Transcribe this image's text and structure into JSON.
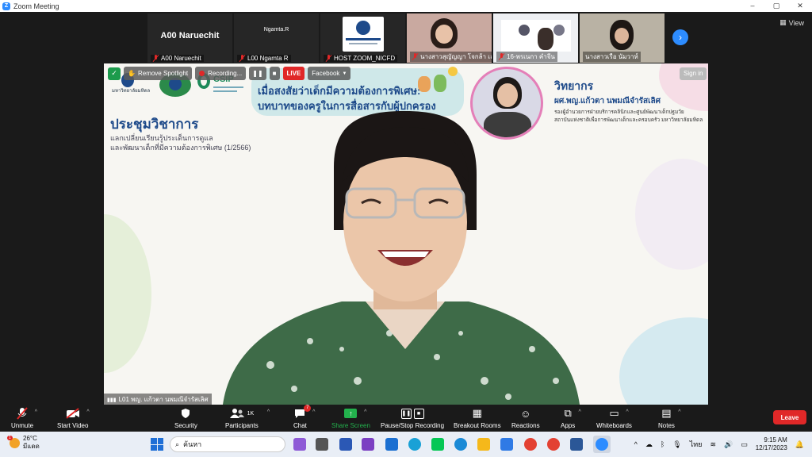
{
  "window": {
    "title": "Zoom Meeting",
    "minimize": "–",
    "maximize": "▢",
    "close": "✕"
  },
  "view_label": "View",
  "thumbnails": [
    {
      "name": "A00 Naruechit",
      "big_label": "A00 Naruechit"
    },
    {
      "name": "L00 Ngamta R",
      "big_label": "Ngamta.R"
    },
    {
      "name": "HOST ZOOM_NICFD",
      "big_label": ""
    },
    {
      "name": "นางสาวสุญัญญา โจกล้า เล..."
    },
    {
      "name": "16-พรเนกา คำจีน"
    },
    {
      "name": "นางสาวเรือ นัมวาห์"
    }
  ],
  "overlay": {
    "remove_spotlight": "Remove Spotlight",
    "recording": "Recording...",
    "live": "LIVE",
    "facebook": "Facebook"
  },
  "sign_in": "Sign in",
  "slide": {
    "banner_line1": "เมื่อสงสัยว่าเด็กมีความต้องการพิเศษ:",
    "banner_line2": "บทบาทของครูในการสื่อสารกับผู้ปกครอง",
    "org1": "มหาวิทยาลัยมหิดล",
    "org2": "CSIP",
    "conf_title": "ประชุมวิชาการ",
    "conf_sub1": "แลกเปลี่ยนเรียนรู้ประเด็นการดูแล",
    "conf_sub2": "และพัฒนาเด็กที่มีความต้องการพิเศษ (1/2566)",
    "speaker_label": "วิทยากร",
    "speaker_name": "ผศ.พญ.แก้วตา นพมณีจำรัสเลิศ",
    "speaker_pos1": "รองผู้อำนวยการฝ่ายบริการคลินิกและศูนย์พัฒนาเด็กปฐมวัย",
    "speaker_pos2": "สถาบันแห่งชาติเพื่อการพัฒนาเด็กและครอบครัว มหาวิทยาลัยมหิดล"
  },
  "active_speaker": "L01 พญ. แก้วตา นพมณีจำรัสเลิศ",
  "toolbar": {
    "unmute": "Unmute",
    "start_video": "Start Video",
    "security": "Security",
    "participants": "Participants",
    "participants_count": "1K",
    "chat": "Chat",
    "chat_badge": "7",
    "share_screen": "Share Screen",
    "pause_recording": "Pause/Stop Recording",
    "breakout_rooms": "Breakout Rooms",
    "reactions": "Reactions",
    "apps": "Apps",
    "whiteboards": "Whiteboards",
    "notes": "Notes",
    "leave": "Leave"
  },
  "taskbar": {
    "temperature": "26°C",
    "weather_text": "มีแดด",
    "weather_badge": "1",
    "search_placeholder": "ค้นหา",
    "language": "ไทย",
    "time": "9:15 AM",
    "date": "12/17/2023"
  },
  "colors": {
    "zoom_blue": "#2d8cff",
    "leave_red": "#e02828",
    "share_green": "#23b14d",
    "slide_title_blue": "#1e4a8a"
  }
}
